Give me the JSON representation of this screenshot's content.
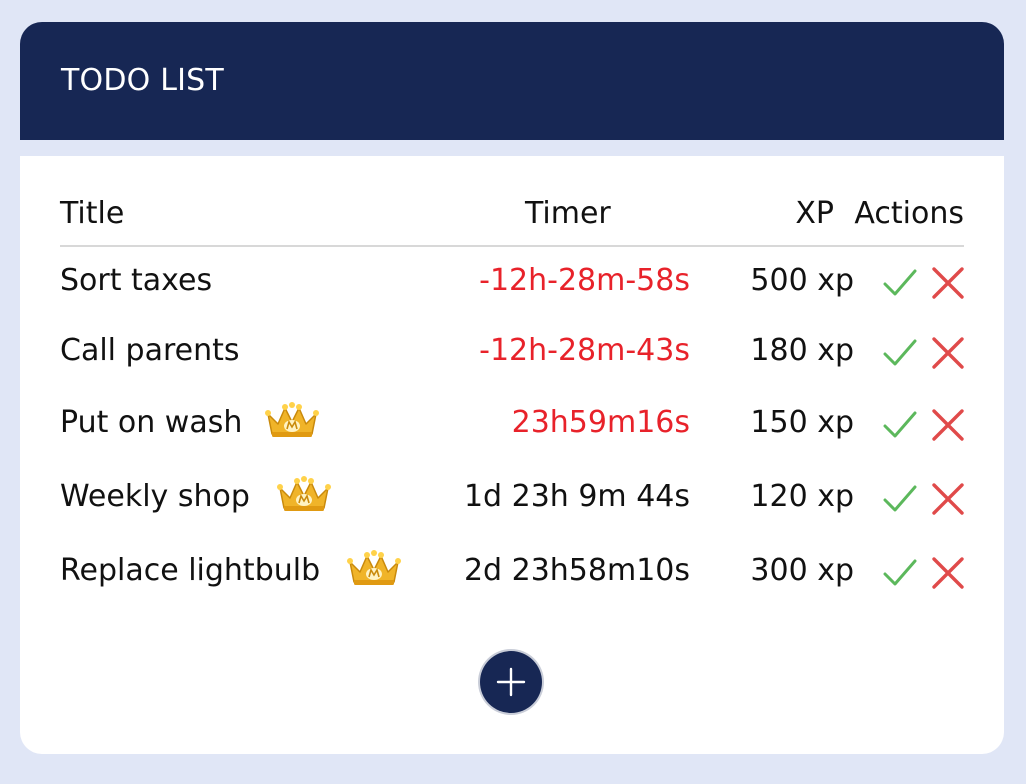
{
  "header": {
    "title": "TODO LIST"
  },
  "table": {
    "columns": {
      "title": "Title",
      "timer": "Timer",
      "xp": "XP",
      "actions": "Actions"
    },
    "rows": [
      {
        "title": "Sort taxes",
        "timer": "-12h-28m-58s",
        "timer_overdue": true,
        "xp": "500 xp",
        "has_crown": false
      },
      {
        "title": "Call parents",
        "timer": "-12h-28m-43s",
        "timer_overdue": true,
        "xp": "180 xp",
        "has_crown": false
      },
      {
        "title": "Put on wash",
        "timer": "23h59m16s",
        "timer_overdue": true,
        "xp": "150 xp",
        "has_crown": true
      },
      {
        "title": "Weekly shop",
        "timer": "1d  23h 9m 44s",
        "timer_overdue": false,
        "xp": "120 xp",
        "has_crown": true
      },
      {
        "title": "Replace lightbulb",
        "timer": "2d 23h58m10s",
        "timer_overdue": false,
        "xp": "300 xp",
        "has_crown": true
      }
    ]
  },
  "icons": {
    "complete": "check-icon",
    "delete": "close-icon",
    "premium": "crown-icon",
    "add": "plus-icon"
  },
  "colors": {
    "header_bg": "#172754",
    "page_bg": "#e0e6f6",
    "overdue": "#e8222a",
    "check": "#5cb85c",
    "delete": "#e04a4a",
    "crown": "#f0b429"
  }
}
